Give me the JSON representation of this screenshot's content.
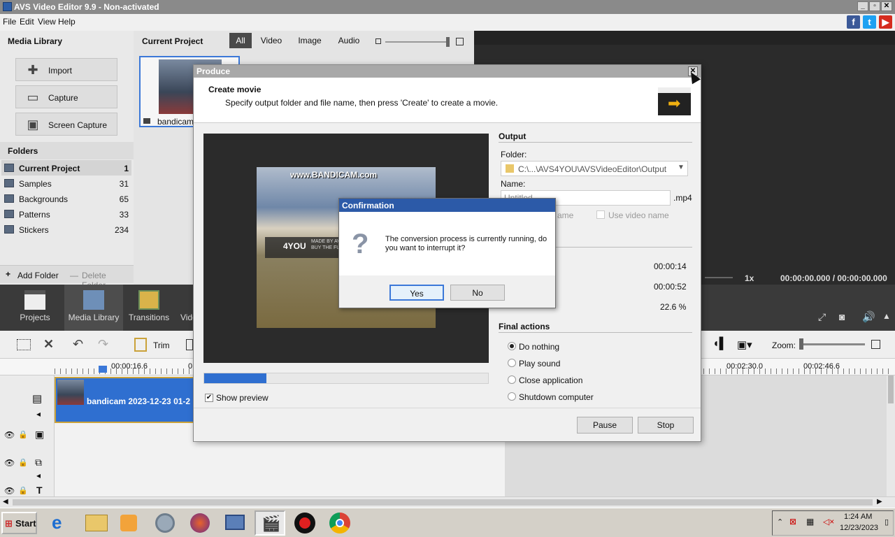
{
  "window": {
    "title": "AVS Video Editor 9.9 - Non-activated"
  },
  "menu": [
    "File",
    "Edit",
    "View",
    "Help"
  ],
  "media_library": {
    "title": "Media Library",
    "buttons": [
      "Import",
      "Capture",
      "Screen Capture"
    ],
    "folders_title": "Folders",
    "folders": [
      {
        "name": "Current Project",
        "count": "1"
      },
      {
        "name": "Samples",
        "count": "31"
      },
      {
        "name": "Backgrounds",
        "count": "65"
      },
      {
        "name": "Patterns",
        "count": "33"
      },
      {
        "name": "Stickers",
        "count": "234"
      }
    ],
    "add_folder": "Add Folder",
    "delete_folder": "Delete Folder"
  },
  "project": {
    "title": "Current Project",
    "tabs": [
      "All",
      "Video",
      "Image",
      "Audio"
    ],
    "clip_label": "bandicam 2"
  },
  "player": {
    "speed": "1x",
    "time": "00:00:00.000 / 00:00:00.000"
  },
  "dark_toolbar": [
    "Projects",
    "Media Library",
    "Transitions",
    "Vide"
  ],
  "timeline": {
    "trim": "Trim",
    "zoom": "Zoom:",
    "ruler": [
      "00:00:16.6",
      "0",
      "00:02:30.0",
      "00:02:46.6"
    ],
    "clip": "bandicam 2023-12-23 01-2"
  },
  "produce": {
    "title": "Produce",
    "heading": "Create movie",
    "subheading": "Specify output folder and file name, then press 'Create' to create a movie.",
    "output_title": "Output",
    "folder_label": "Folder:",
    "folder_value": "C:\\...\\AVS4YOU\\AVSVideoEditor\\Output",
    "name_label": "Name:",
    "name_value": "Untitled",
    "ext": ".mp4",
    "use_project_name_partial": "ame",
    "use_video_name": "Use video name",
    "stat_values": [
      "00:00:14",
      "00:00:52",
      "22.6 %"
    ],
    "final_actions_title": "Final actions",
    "final_actions": [
      "Do nothing",
      "Play sound",
      "Close application",
      "Shutdown computer"
    ],
    "selected_action": 0,
    "show_preview": "Show preview",
    "progress_fraction": 0.22,
    "pause": "Pause",
    "stop": "Stop",
    "preview_watermark": "www.BANDICAM.com",
    "preview_logo": "4YOU",
    "preview_text1": "MADE BY AVS",
    "preview_text2": "BUY THE FU"
  },
  "confirmation": {
    "title": "Confirmation",
    "message": "The conversion process is currently running, do you want to interrupt it?",
    "yes": "Yes",
    "no": "No"
  },
  "taskbar": {
    "start": "Start",
    "time": "1:24 AM",
    "date": "12/23/2023"
  }
}
